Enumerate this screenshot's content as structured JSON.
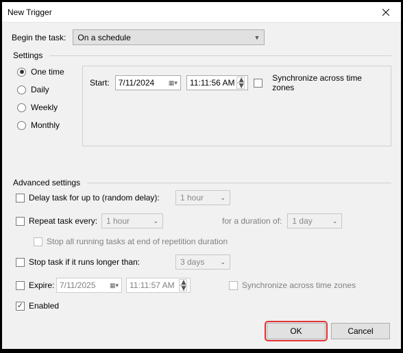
{
  "window": {
    "title": "New Trigger"
  },
  "begin": {
    "label": "Begin the task:",
    "value": "On a schedule"
  },
  "settings": {
    "group_label": "Settings",
    "radios": {
      "one_time": "One time",
      "daily": "Daily",
      "weekly": "Weekly",
      "monthly": "Monthly"
    },
    "start_label": "Start:",
    "start_date": "7/11/2024",
    "start_time": "11:11:56 AM",
    "sync_label": "Synchronize across time zones"
  },
  "advanced": {
    "group_label": "Advanced settings",
    "delay_label": "Delay task for up to (random delay):",
    "delay_value": "1 hour",
    "repeat_label": "Repeat task every:",
    "repeat_value": "1 hour",
    "duration_label": "for a duration of:",
    "duration_value": "1 day",
    "stop_running_label": "Stop all running tasks at end of repetition duration",
    "stop_longer_label": "Stop task if it runs longer than:",
    "stop_longer_value": "3 days",
    "expire_label": "Expire:",
    "expire_date": "7/11/2025",
    "expire_time": "11:11:57 AM",
    "expire_sync_label": "Synchronize across time zones",
    "enabled_label": "Enabled"
  },
  "buttons": {
    "ok": "OK",
    "cancel": "Cancel"
  }
}
